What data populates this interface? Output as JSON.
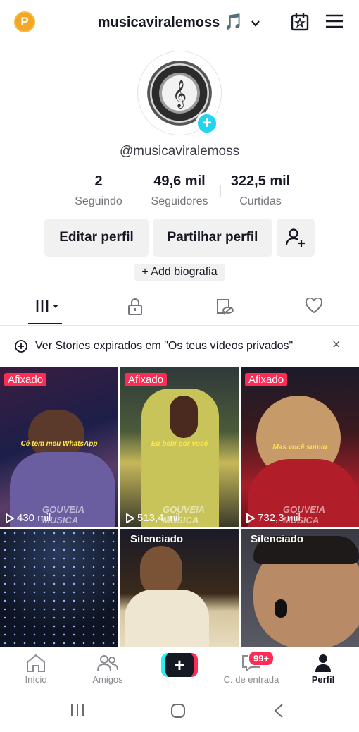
{
  "header": {
    "badge_letter": "P",
    "username": "musicaviralemoss",
    "username_emoji": "🎵"
  },
  "profile": {
    "handle": "@musicaviralemoss",
    "stats": [
      {
        "value": "2",
        "label": "Seguindo"
      },
      {
        "value": "49,6 mil",
        "label": "Seguidores"
      },
      {
        "value": "322,5 mil",
        "label": "Curtidas"
      }
    ],
    "edit_label": "Editar perfil",
    "share_label": "Partilhar perfil",
    "bio_label": "+ Add biografia"
  },
  "banner": {
    "text": "Ver Stories expirados em \"Os teus vídeos privados\"",
    "close": "×"
  },
  "videos": [
    {
      "tag": "Afixado",
      "views": "430 mil",
      "caption": "Cê tem meu WhatsApp",
      "watermark": "GOUVEIA MUSICA"
    },
    {
      "tag": "Afixado",
      "views": "513,4 mil",
      "caption": "Eu bebi por você",
      "watermark": "GOUVEIA MUSICA"
    },
    {
      "tag": "Afixado",
      "views": "732,3 mil",
      "caption": "Mas você sumiu",
      "watermark": "GOUVEIA MUSICA"
    },
    {
      "tag": "",
      "views": ""
    },
    {
      "tag": "Silenciado",
      "views": ""
    },
    {
      "tag": "Silenciado",
      "views": ""
    }
  ],
  "bottom_nav": {
    "home": "Início",
    "friends": "Amigos",
    "inbox": "C. de entrada",
    "inbox_badge": "99+",
    "profile": "Perfil"
  }
}
